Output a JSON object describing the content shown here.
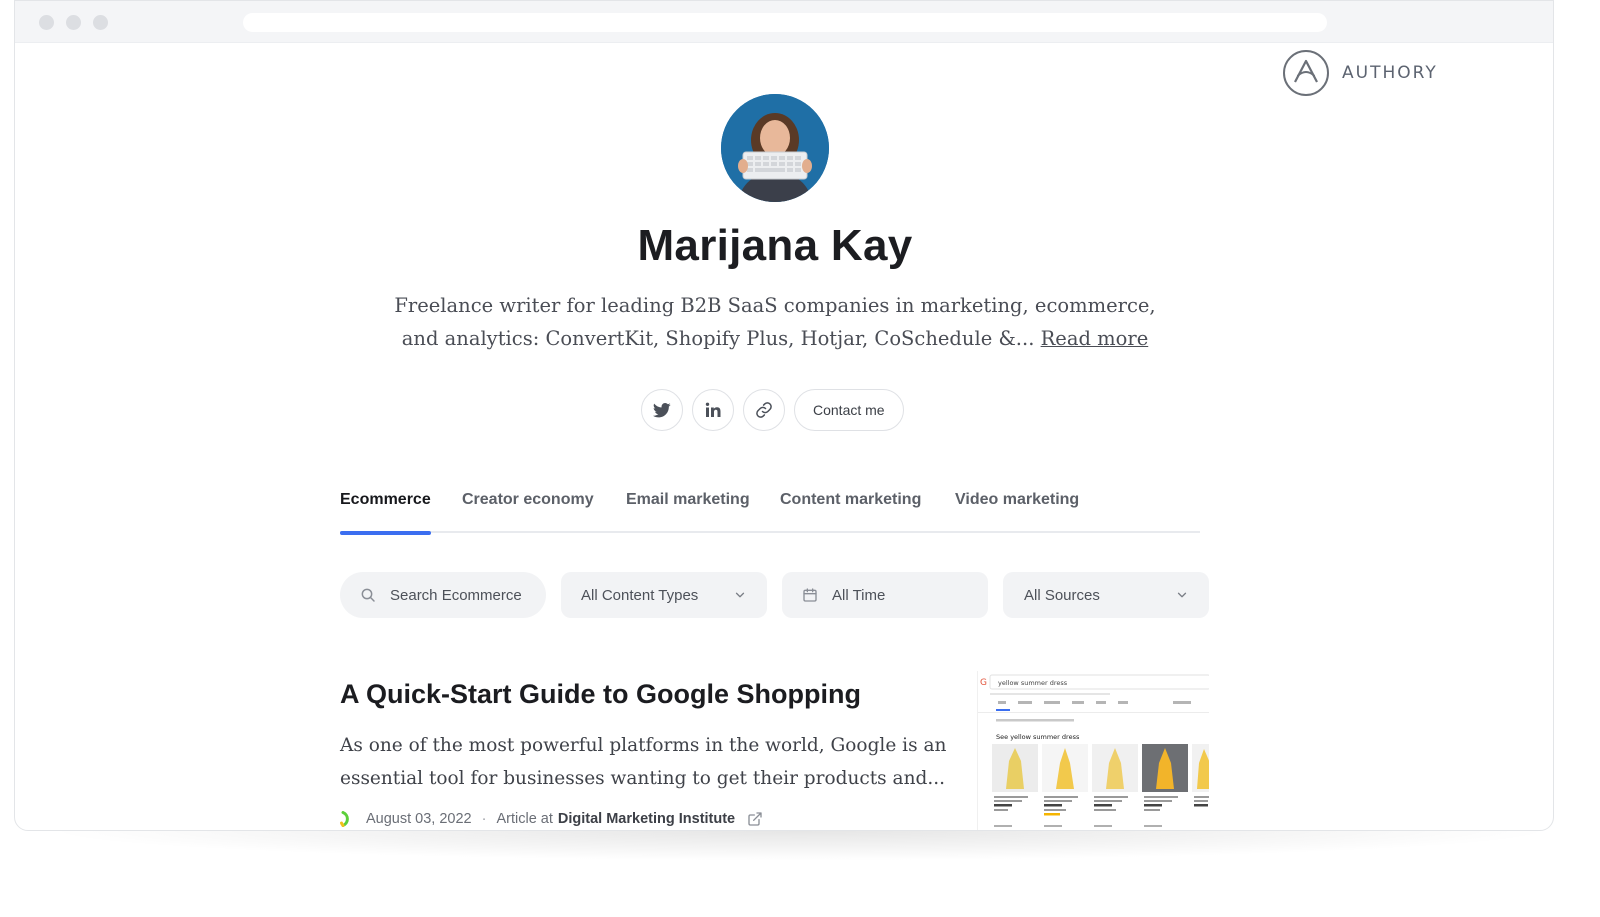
{
  "brand": {
    "name": "AUTHORY",
    "logo_icon": "authory-logo-icon"
  },
  "profile": {
    "name": "Marijana Kay",
    "bio": "Freelance writer for leading B2B SaaS companies in marketing, ecommerce, and analytics: ConvertKit, Shopify Plus, Hotjar, CoSchedule &...",
    "read_more": "Read more",
    "avatar_icon": "avatar-photo"
  },
  "social": {
    "twitter_icon": "twitter-icon",
    "linkedin_icon": "linkedin-icon",
    "link_icon": "link-icon",
    "contact_label": "Contact me"
  },
  "tabs": [
    {
      "label": "Ecommerce",
      "active": true
    },
    {
      "label": "Creator economy",
      "active": false
    },
    {
      "label": "Email marketing",
      "active": false
    },
    {
      "label": "Content marketing",
      "active": false
    },
    {
      "label": "Video marketing",
      "active": false
    }
  ],
  "filters": {
    "search_placeholder": "Search Ecommerce",
    "content_types": "All Content Types",
    "time": "All Time",
    "sources": "All Sources"
  },
  "articles": [
    {
      "title": "A Quick-Start Guide to Google Shopping",
      "excerpt": "As one of the most powerful platforms in the world, Google is an essential tool for businesses wanting to get their products and...",
      "date": "August 03, 2022",
      "type_prefix": "Article at",
      "publication": "Digital Marketing Institute",
      "thumbnail": {
        "search_query": "yellow summer dress",
        "section_heading": "See yellow summer dress"
      }
    }
  ],
  "colors": {
    "accent": "#3b6ef0",
    "text_dark": "#1c1d21",
    "filter_bg": "#f2f3f5"
  }
}
